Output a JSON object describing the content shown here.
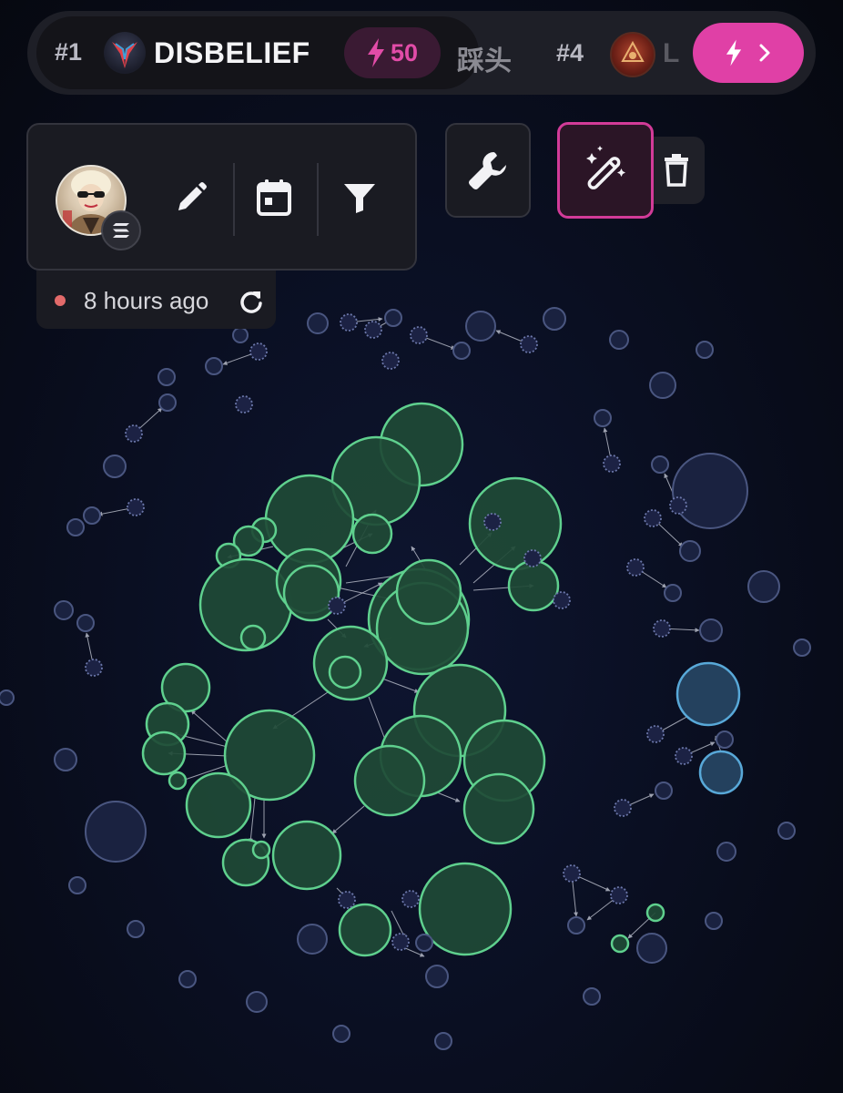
{
  "ranking": {
    "first": {
      "rank": "#1",
      "name": "DISBELIEF",
      "score": "50"
    },
    "partial_text": "踩头",
    "fourth": {
      "rank": "#4",
      "name_partial": "L"
    }
  },
  "toolbar": {
    "avatar_label": "profile avatar",
    "status_text": "8 hours ago",
    "status_color": "#e26a6a"
  },
  "colors": {
    "accent": "#e040a6",
    "cluster_fill": "#1f4a36",
    "cluster_stroke": "#5fd08e",
    "neutral_node": "#1a2240",
    "neutral_stroke": "#4a5680",
    "blue_node_stroke": "#58a8d8"
  },
  "icons": [
    "lightning-icon",
    "chevron-right-icon",
    "pencil-icon",
    "calendar-icon",
    "filter-icon",
    "refresh-icon",
    "wrench-icon",
    "magic-wand-icon",
    "trash-icon",
    "solana-icon"
  ]
}
